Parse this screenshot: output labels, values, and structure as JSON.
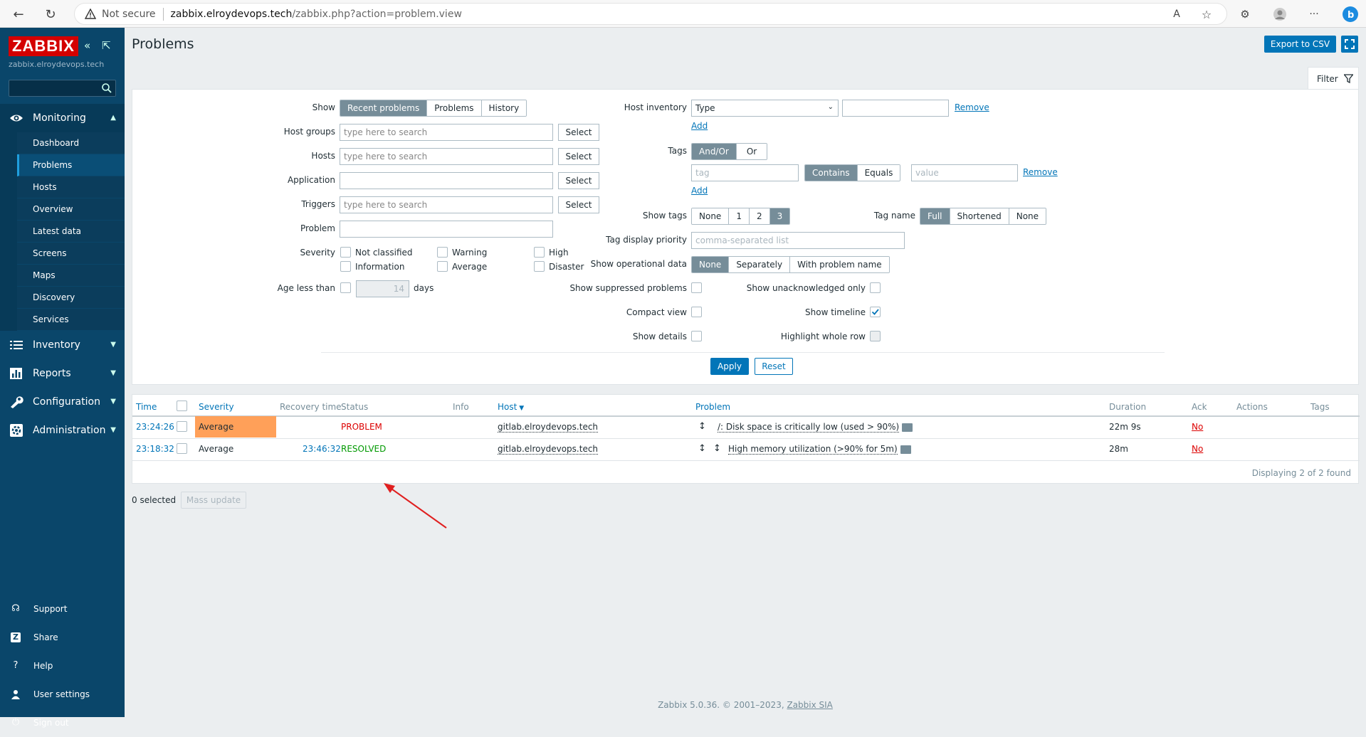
{
  "browser": {
    "security": "Not secure",
    "url_domain": "zabbix.elroydevops.tech",
    "url_path": "/zabbix.php?action=problem.view"
  },
  "sidebar": {
    "logo": "ZABBIX",
    "server_name": "zabbix.elroydevops.tech",
    "sections": [
      {
        "label": "Monitoring",
        "icon": "eye-icon"
      },
      {
        "label": "Inventory",
        "icon": "list-icon"
      },
      {
        "label": "Reports",
        "icon": "chart-icon"
      },
      {
        "label": "Configuration",
        "icon": "wrench-icon"
      },
      {
        "label": "Administration",
        "icon": "gear-icon"
      }
    ],
    "monitoring_items": [
      "Dashboard",
      "Problems",
      "Hosts",
      "Overview",
      "Latest data",
      "Screens",
      "Maps",
      "Discovery",
      "Services"
    ],
    "bottom": [
      "Support",
      "Share",
      "Help",
      "User settings",
      "Sign out"
    ]
  },
  "header": {
    "title": "Problems",
    "export": "Export to CSV",
    "filter_tab": "Filter"
  },
  "filter": {
    "show_label": "Show",
    "show_options": [
      "Recent problems",
      "Problems",
      "History"
    ],
    "host_groups_label": "Host groups",
    "hosts_label": "Hosts",
    "application_label": "Application",
    "triggers_label": "Triggers",
    "problem_label": "Problem",
    "severity_label": "Severity",
    "age_label": "Age less than",
    "search_placeholder": "type here to search",
    "select": "Select",
    "severities": [
      "Not classified",
      "Information",
      "Warning",
      "Average",
      "High",
      "Disaster"
    ],
    "age_value": "14",
    "age_unit": "days",
    "host_inventory_label": "Host inventory",
    "host_inventory_type": "Type",
    "remove": "Remove",
    "add": "Add",
    "tags_label": "Tags",
    "tags_mode": [
      "And/Or",
      "Or"
    ],
    "tag_placeholder": "tag",
    "tag_ops": [
      "Contains",
      "Equals"
    ],
    "value_placeholder": "value",
    "show_tags_label": "Show tags",
    "show_tags_options": [
      "None",
      "1",
      "2",
      "3"
    ],
    "tag_name_label": "Tag name",
    "tag_name_options": [
      "Full",
      "Shortened",
      "None"
    ],
    "tag_priority_label": "Tag display priority",
    "tag_priority_placeholder": "comma-separated list",
    "opdata_label": "Show operational data",
    "opdata_options": [
      "None",
      "Separately",
      "With problem name"
    ],
    "suppressed_label": "Show suppressed problems",
    "unack_label": "Show unacknowledged only",
    "compact_label": "Compact view",
    "timeline_label": "Show timeline",
    "details_label": "Show details",
    "highlight_label": "Highlight whole row",
    "apply": "Apply",
    "reset": "Reset"
  },
  "table": {
    "headers": [
      "Time",
      "Severity",
      "Recovery time",
      "Status",
      "Info",
      "Host",
      "Problem",
      "Duration",
      "Ack",
      "Actions",
      "Tags"
    ],
    "rows": [
      {
        "time": "23:24:26",
        "severity": "Average",
        "recovery": "",
        "status": "PROBLEM",
        "host": "gitlab.elroydevops.tech",
        "problem": "/: Disk space is critically low (used > 90%)",
        "duration": "22m 9s",
        "ack": "No"
      },
      {
        "time": "23:18:32",
        "severity": "Average",
        "recovery": "23:46:32",
        "status": "RESOLVED",
        "host": "gitlab.elroydevops.tech",
        "problem": "High memory utilization (>90% for 5m)",
        "duration": "28m",
        "ack": "No"
      }
    ],
    "displaying": "Displaying 2 of 2 found",
    "colors": {
      "problem": "#dc0000",
      "resolved": "#009900",
      "average": "#ffa059"
    }
  },
  "footer": {
    "selected": "0 selected",
    "mass_update": "Mass update",
    "copyright": "Zabbix 5.0.36. © 2001–2023,",
    "company": "Zabbix SIA"
  }
}
